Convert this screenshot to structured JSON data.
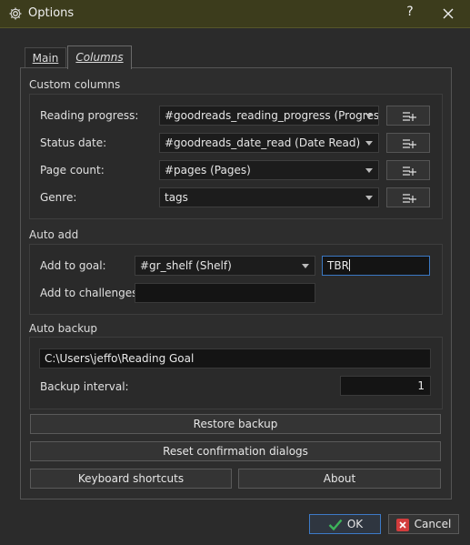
{
  "window": {
    "title": "Options",
    "help_label": "?"
  },
  "tabs": [
    {
      "label": "Main"
    },
    {
      "label": "Columns"
    }
  ],
  "custom_columns": {
    "title": "Custom columns",
    "rows": [
      {
        "label": "Reading progress:",
        "value": "#goodreads_reading_progress (Progress)"
      },
      {
        "label": "Status date:",
        "value": "#goodreads_date_read (Date Read)"
      },
      {
        "label": "Page count:",
        "value": "#pages (Pages)"
      },
      {
        "label": "Genre:",
        "value": "tags"
      }
    ],
    "add_button_icon": "add-column-icon"
  },
  "auto_add": {
    "title": "Auto add",
    "goal_label": "Add to goal:",
    "goal_column": "#gr_shelf (Shelf)",
    "goal_value": "TBR",
    "challenges_label": "Add to challenges:",
    "challenges_value": ""
  },
  "auto_backup": {
    "title": "Auto backup",
    "path": "C:\\Users\\jeffo\\Reading Goal",
    "interval_label": "Backup interval:",
    "interval_value": "1"
  },
  "actions": {
    "restore": "Restore backup",
    "reset": "Reset confirmation dialogs",
    "shortcuts": "Keyboard shortcuts",
    "about": "About"
  },
  "footer": {
    "ok": "OK",
    "cancel": "Cancel"
  },
  "colors": {
    "accent": "#3a78c3",
    "ok_check": "#3db35a",
    "cancel_x": "#d23c3c"
  }
}
